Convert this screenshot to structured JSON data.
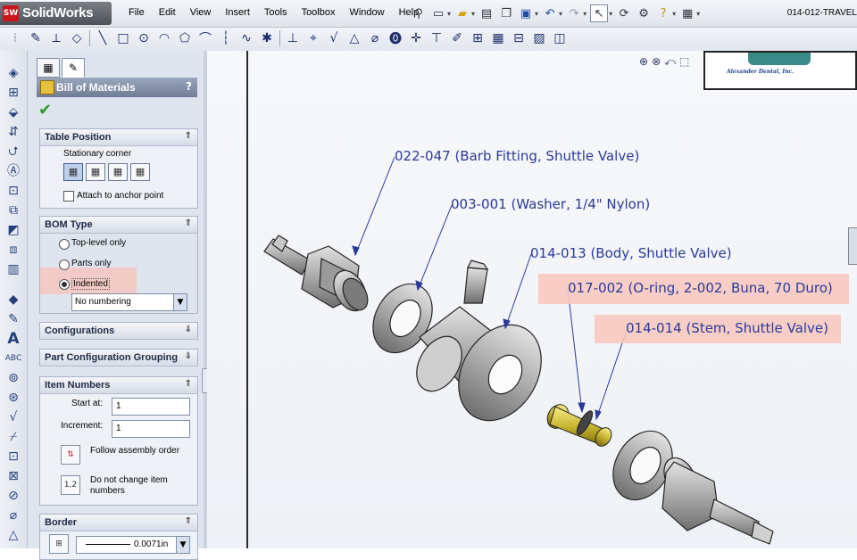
{
  "app": {
    "name": "SolidWorks",
    "badge": "SW",
    "doc_title": "014-012-TRAVEL"
  },
  "menu": [
    "File",
    "Edit",
    "View",
    "Insert",
    "Tools",
    "Toolbox",
    "Window",
    "Help"
  ],
  "property_manager": {
    "title": "Bill of Materials",
    "help": "?",
    "table_position": {
      "header": "Table Position",
      "stationary_corner_label": "Stationary corner",
      "attach_label": "Attach to anchor point",
      "attach_checked": false
    },
    "bom_type": {
      "header": "BOM Type",
      "options": [
        "Top-level only",
        "Parts only",
        "Indented"
      ],
      "selected": "Indented",
      "numbering": "No numbering"
    },
    "configurations": {
      "header": "Configurations"
    },
    "part_config_grouping": {
      "header": "Part Configuration Grouping"
    },
    "item_numbers": {
      "header": "Item Numbers",
      "start_label": "Start at:",
      "start_value": "1",
      "increment_label": "Increment:",
      "increment_value": "1",
      "follow_label": "Follow assembly order",
      "dont_change_label": "Do not change item numbers",
      "dont_change_btn": "1,2"
    },
    "border": {
      "header": "Border",
      "thickness": "0.0071in"
    }
  },
  "annotations": [
    "022-047 (Barb Fitting, Shuttle Valve)",
    "003-001 (Washer, 1/4\" Nylon)",
    "014-013 (Body, Shuttle Valve)",
    "017-002 (O-ring, 2-002, Buna, 70 Duro)",
    "014-014 (Stem, Shuttle Valve)"
  ],
  "title_block": {
    "company": "Alexander Dental, Inc."
  },
  "colors": {
    "annotation": "#2a3a9a",
    "highlight": "#f7c9bf",
    "accent_red": "#c8161b"
  }
}
